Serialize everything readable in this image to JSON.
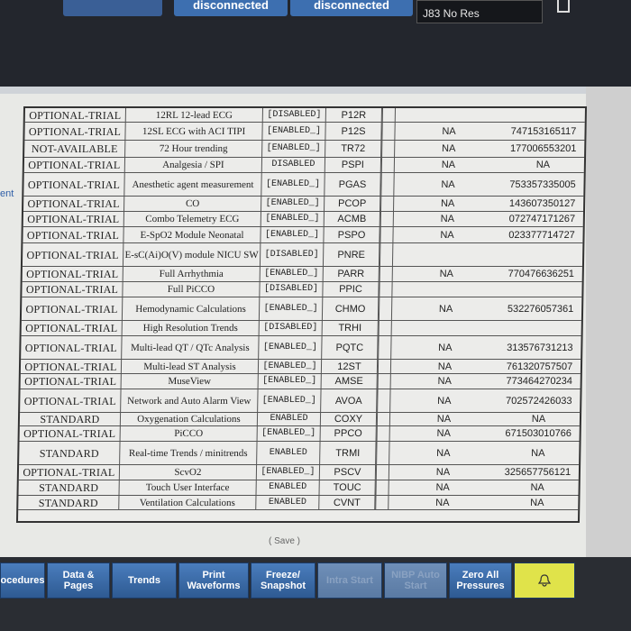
{
  "top": {
    "btn1": "disconnected",
    "btn2": "disconnected",
    "j83": "J83 No Res"
  },
  "side_fragment": "ent",
  "rows": [
    {
      "status": "OPTIONAL-TRIAL",
      "name": "12RL 12-lead ECG",
      "state": "[DISABLED]",
      "code": "P12R",
      "na": "",
      "key": ""
    },
    {
      "status": "OPTIONAL-TRIAL",
      "name": "12SL ECG with ACI TIPI",
      "state": "[ENABLED_]",
      "code": "P12S",
      "na": "NA",
      "key": "747153165117"
    },
    {
      "status": "NOT-AVAILABLE",
      "name": "72 Hour trending",
      "state": "[ENABLED_]",
      "code": "TR72",
      "na": "NA",
      "key": "177006553201"
    },
    {
      "status": "OPTIONAL-TRIAL",
      "name": "Analgesia / SPI",
      "state": "DISABLED",
      "code": "PSPI",
      "na": "NA",
      "key": "NA"
    },
    {
      "status": "OPTIONAL-TRIAL",
      "name": "Anesthetic agent measurement",
      "state": "[ENABLED_]",
      "code": "PGAS",
      "na": "NA",
      "key": "753357335005"
    },
    {
      "status": "OPTIONAL-TRIAL",
      "name": "CO",
      "state": "[ENABLED_]",
      "code": "PCOP",
      "na": "NA",
      "key": "143607350127"
    },
    {
      "status": "OPTIONAL-TRIAL",
      "name": "Combo Telemetry ECG",
      "state": "[ENABLED_]",
      "code": "ACMB",
      "na": "NA",
      "key": "072747171267"
    },
    {
      "status": "OPTIONAL-TRIAL",
      "name": "E-SpO2 Module Neonatal",
      "state": "[ENABLED_]",
      "code": "PSPO",
      "na": "NA",
      "key": "023377714727"
    },
    {
      "status": "OPTIONAL-TRIAL",
      "name": "E-sC(Ai)O(V) module NICU SW",
      "state": "[DISABLED]",
      "code": "PNRE",
      "na": "",
      "key": ""
    },
    {
      "status": "OPTIONAL-TRIAL",
      "name": "Full Arrhythmia",
      "state": "[ENABLED_]",
      "code": "PARR",
      "na": "NA",
      "key": "770476636251"
    },
    {
      "status": "OPTIONAL-TRIAL",
      "name": "Full PiCCO",
      "state": "[DISABLED]",
      "code": "PPIC",
      "na": "",
      "key": ""
    },
    {
      "status": "OPTIONAL-TRIAL",
      "name": "Hemodynamic Calculations",
      "state": "[ENABLED_]",
      "code": "CHMO",
      "na": "NA",
      "key": "532276057361"
    },
    {
      "status": "OPTIONAL-TRIAL",
      "name": "High Resolution Trends",
      "state": "[DISABLED]",
      "code": "TRHI",
      "na": "",
      "key": ""
    },
    {
      "status": "OPTIONAL-TRIAL",
      "name": "Multi-lead QT / QTc Analysis",
      "state": "[ENABLED_]",
      "code": "PQTC",
      "na": "NA",
      "key": "313576731213"
    },
    {
      "status": "OPTIONAL-TRIAL",
      "name": "Multi-lead ST Analysis",
      "state": "[ENABLED_]",
      "code": "12ST",
      "na": "NA",
      "key": "761320757507"
    },
    {
      "status": "OPTIONAL-TRIAL",
      "name": "MuseView",
      "state": "[ENABLED_]",
      "code": "AMSE",
      "na": "NA",
      "key": "773464270234"
    },
    {
      "status": "OPTIONAL-TRIAL",
      "name": "Network and Auto Alarm View",
      "state": "[ENABLED_]",
      "code": "AVOA",
      "na": "NA",
      "key": "702572426033"
    },
    {
      "status": "STANDARD",
      "name": "Oxygenation Calculations",
      "state": "ENABLED",
      "code": "COXY",
      "na": "NA",
      "key": "NA"
    },
    {
      "status": "OPTIONAL-TRIAL",
      "name": "PiCCO",
      "state": "[ENABLED_]",
      "code": "PPCO",
      "na": "NA",
      "key": "671503010766"
    },
    {
      "status": "STANDARD",
      "name": "Real-time Trends / minitrends",
      "state": "ENABLED",
      "code": "TRMI",
      "na": "NA",
      "key": "NA"
    },
    {
      "status": "OPTIONAL-TRIAL",
      "name": "ScvO2",
      "state": "[ENABLED_]",
      "code": "PSCV",
      "na": "NA",
      "key": "325657756121"
    },
    {
      "status": "STANDARD",
      "name": "Touch User Interface",
      "state": "ENABLED",
      "code": "TOUC",
      "na": "NA",
      "key": "NA"
    },
    {
      "status": "STANDARD",
      "name": "Ventilation Calculations",
      "state": "ENABLED",
      "code": "CVNT",
      "na": "NA",
      "key": "NA"
    }
  ],
  "save_label": "( Save )",
  "bottom": {
    "procedures": "ocedures",
    "data_pages": "Data & Pages",
    "trends": "Trends",
    "print_waveforms": "Print Waveforms",
    "freeze_snapshot": "Freeze/ Snapshot",
    "intra_start": "Intra Start",
    "nibp_auto": "NIBP Auto Start",
    "zero_all": "Zero All Pressures"
  },
  "colors": {
    "button_blue": "#3d6fb0",
    "alarm_yellow": "#e0e34a",
    "screen_bg": "#e8e9e6"
  }
}
